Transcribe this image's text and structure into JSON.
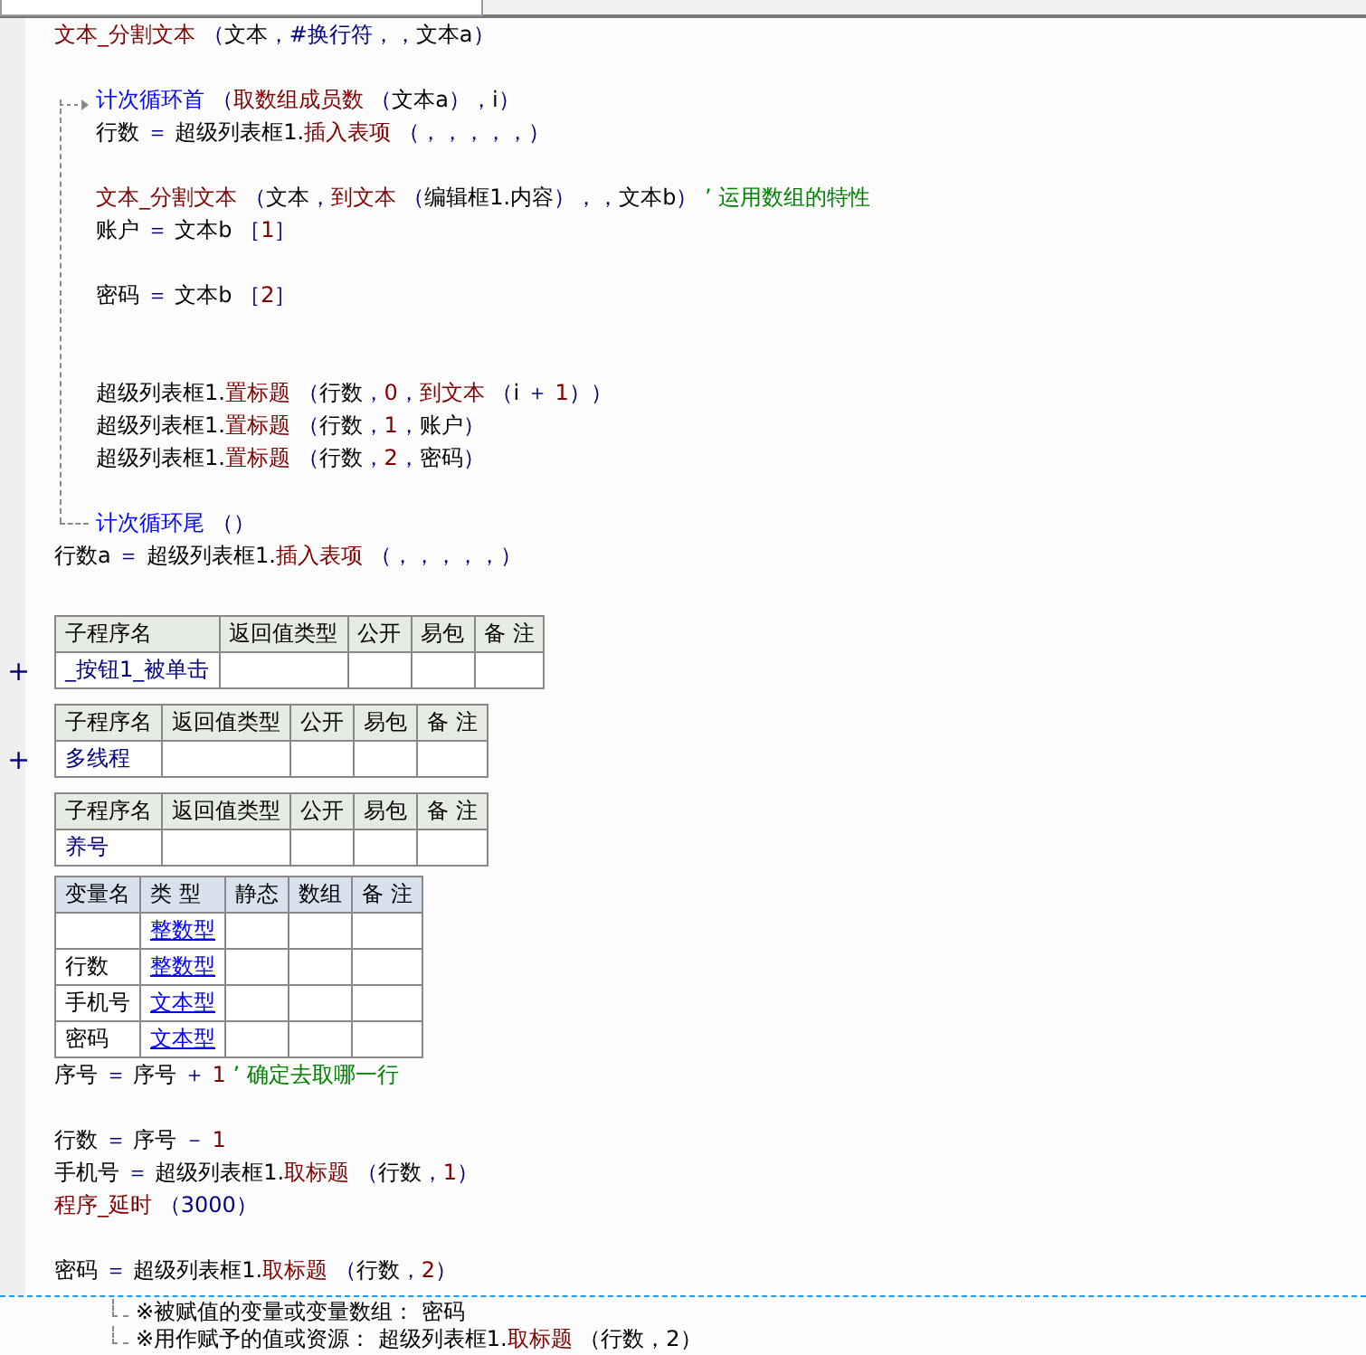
{
  "code": [
    {
      "kind": "line",
      "tokens": [
        {
          "kind": "f",
          "text": "文本_分割文本"
        },
        {
          "kind": "o",
          "text": " （"
        },
        {
          "kind": "p",
          "text": "文本"
        },
        {
          "kind": "o",
          "text": "，"
        },
        {
          "kind": "o",
          "text": "#换行符"
        },
        {
          "kind": "o",
          "text": "，，"
        },
        {
          "kind": "p",
          "text": "文本a"
        },
        {
          "kind": "o",
          "text": "）"
        }
      ]
    },
    {
      "kind": "blank"
    },
    {
      "kind": "loop",
      "head": [
        {
          "kind": "k",
          "text": "计次循环首"
        },
        {
          "kind": "o",
          "text": " （"
        },
        {
          "kind": "f",
          "text": "取数组成员数"
        },
        {
          "kind": "o",
          "text": " （"
        },
        {
          "kind": "p",
          "text": "文本a"
        },
        {
          "kind": "o",
          "text": "），"
        },
        {
          "kind": "p",
          "text": "i"
        },
        {
          "kind": "o",
          "text": "）"
        }
      ],
      "children": [
        {
          "kind": "line",
          "tokens": [
            {
              "kind": "p",
              "text": "行数"
            },
            {
              "kind": "o",
              "text": " ＝ "
            },
            {
              "kind": "p",
              "text": "超级列表框1."
            },
            {
              "kind": "f",
              "text": "插入表项"
            },
            {
              "kind": "o",
              "text": " （，，，，，）"
            }
          ]
        },
        {
          "kind": "blank"
        },
        {
          "kind": "line",
          "tokens": [
            {
              "kind": "f",
              "text": "文本_分割文本"
            },
            {
              "kind": "o",
              "text": " （"
            },
            {
              "kind": "p",
              "text": "文本"
            },
            {
              "kind": "o",
              "text": "，"
            },
            {
              "kind": "f",
              "text": "到文本"
            },
            {
              "kind": "o",
              "text": " （"
            },
            {
              "kind": "p",
              "text": "编辑框1.内容"
            },
            {
              "kind": "o",
              "text": "），，"
            },
            {
              "kind": "p",
              "text": "文本b"
            },
            {
              "kind": "o",
              "text": "）"
            },
            {
              "kind": "c",
              "text": " ’ 运用数组的特性"
            }
          ]
        },
        {
          "kind": "line",
          "tokens": [
            {
              "kind": "p",
              "text": "账户"
            },
            {
              "kind": "o",
              "text": " ＝ "
            },
            {
              "kind": "p",
              "text": "文本b "
            },
            {
              "kind": "o",
              "text": "［"
            },
            {
              "kind": "n",
              "text": "1"
            },
            {
              "kind": "o",
              "text": "］"
            }
          ]
        },
        {
          "kind": "blank"
        },
        {
          "kind": "line",
          "tokens": [
            {
              "kind": "p",
              "text": "密码"
            },
            {
              "kind": "o",
              "text": " ＝ "
            },
            {
              "kind": "p",
              "text": "文本b "
            },
            {
              "kind": "o",
              "text": "［"
            },
            {
              "kind": "n",
              "text": "2"
            },
            {
              "kind": "o",
              "text": "］"
            }
          ]
        },
        {
          "kind": "blank"
        },
        {
          "kind": "blank"
        },
        {
          "kind": "line",
          "tokens": [
            {
              "kind": "p",
              "text": "超级列表框1."
            },
            {
              "kind": "f",
              "text": "置标题"
            },
            {
              "kind": "o",
              "text": " （"
            },
            {
              "kind": "p",
              "text": "行数"
            },
            {
              "kind": "o",
              "text": "，"
            },
            {
              "kind": "n",
              "text": "0"
            },
            {
              "kind": "o",
              "text": "，"
            },
            {
              "kind": "f",
              "text": "到文本"
            },
            {
              "kind": "o",
              "text": " （"
            },
            {
              "kind": "p",
              "text": "i"
            },
            {
              "kind": "o",
              "text": " ＋ "
            },
            {
              "kind": "n",
              "text": "1"
            },
            {
              "kind": "o",
              "text": "））"
            }
          ]
        },
        {
          "kind": "line",
          "tokens": [
            {
              "kind": "p",
              "text": "超级列表框1."
            },
            {
              "kind": "f",
              "text": "置标题"
            },
            {
              "kind": "o",
              "text": " （"
            },
            {
              "kind": "p",
              "text": "行数"
            },
            {
              "kind": "o",
              "text": "，"
            },
            {
              "kind": "n",
              "text": "1"
            },
            {
              "kind": "o",
              "text": "，"
            },
            {
              "kind": "p",
              "text": "账户"
            },
            {
              "kind": "o",
              "text": "）"
            }
          ]
        },
        {
          "kind": "line",
          "tokens": [
            {
              "kind": "p",
              "text": "超级列表框1."
            },
            {
              "kind": "f",
              "text": "置标题"
            },
            {
              "kind": "o",
              "text": " （"
            },
            {
              "kind": "p",
              "text": "行数"
            },
            {
              "kind": "o",
              "text": "，"
            },
            {
              "kind": "n",
              "text": "2"
            },
            {
              "kind": "o",
              "text": "，"
            },
            {
              "kind": "p",
              "text": "密码"
            },
            {
              "kind": "o",
              "text": "）"
            }
          ]
        },
        {
          "kind": "blank"
        }
      ],
      "tail": [
        {
          "kind": "k",
          "text": "计次循环尾"
        },
        {
          "kind": "o",
          "text": " （）"
        }
      ]
    },
    {
      "kind": "line",
      "tokens": [
        {
          "kind": "p",
          "text": "行数a"
        },
        {
          "kind": "o",
          "text": " ＝ "
        },
        {
          "kind": "p",
          "text": "超级列表框1."
        },
        {
          "kind": "f",
          "text": "插入表项"
        },
        {
          "kind": "o",
          "text": " （，，，，，）"
        }
      ]
    }
  ],
  "subroutines": [
    {
      "toggle": "+",
      "columns": [
        "子程序名",
        "返回值类型",
        "公开",
        "易包",
        "备 注"
      ],
      "name": "_按钮1_被单击"
    },
    {
      "toggle": "+",
      "columns": [
        "子程序名",
        "返回值类型",
        "公开",
        "易包",
        "备 注"
      ],
      "name": "多线程"
    },
    {
      "columns": [
        "子程序名",
        "返回值类型",
        "公开",
        "易包",
        "备 注"
      ],
      "name": "养号"
    }
  ],
  "variables": {
    "columns": [
      "变量名",
      "类 型",
      "静态",
      "数组",
      "备 注"
    ],
    "rows": [
      {
        "type": "整数型"
      },
      {
        "name": "行数",
        "type": "整数型"
      },
      {
        "name": "手机号",
        "type": "文本型"
      },
      {
        "name": "密码",
        "type": "文本型"
      }
    ]
  },
  "code_after": [
    {
      "kind": "line",
      "tokens": [
        {
          "kind": "p",
          "text": "序号"
        },
        {
          "kind": "o",
          "text": " ＝ "
        },
        {
          "kind": "p",
          "text": "序号"
        },
        {
          "kind": "o",
          "text": " ＋ "
        },
        {
          "kind": "n",
          "text": "1"
        },
        {
          "kind": "c",
          "text": " ’ 确定去取哪一行"
        }
      ]
    },
    {
      "kind": "blank"
    },
    {
      "kind": "line",
      "tokens": [
        {
          "kind": "p",
          "text": "行数"
        },
        {
          "kind": "o",
          "text": " ＝ "
        },
        {
          "kind": "p",
          "text": "序号"
        },
        {
          "kind": "o",
          "text": " － "
        },
        {
          "kind": "n",
          "text": "1"
        }
      ]
    },
    {
      "kind": "line",
      "tokens": [
        {
          "kind": "p",
          "text": "手机号"
        },
        {
          "kind": "o",
          "text": " ＝ "
        },
        {
          "kind": "p",
          "text": "超级列表框1."
        },
        {
          "kind": "f",
          "text": "取标题"
        },
        {
          "kind": "o",
          "text": " （"
        },
        {
          "kind": "p",
          "text": "行数"
        },
        {
          "kind": "o",
          "text": "，"
        },
        {
          "kind": "n",
          "text": "1"
        },
        {
          "kind": "o",
          "text": "）"
        }
      ]
    },
    {
      "kind": "line",
      "tokens": [
        {
          "kind": "f",
          "text": "程序_延时"
        },
        {
          "kind": "o",
          "text": " （3000）"
        }
      ]
    },
    {
      "kind": "blank"
    },
    {
      "kind": "line",
      "tokens": [
        {
          "kind": "p",
          "text": "密码"
        },
        {
          "kind": "o",
          "text": " ＝ "
        },
        {
          "kind": "p",
          "text": "超级列表框1."
        },
        {
          "kind": "f",
          "text": "取标题"
        },
        {
          "kind": "o",
          "text": " （"
        },
        {
          "kind": "p",
          "text": "行数"
        },
        {
          "kind": "o",
          "text": "，"
        },
        {
          "kind": "n",
          "text": "2"
        },
        {
          "kind": "o",
          "text": "）"
        }
      ]
    }
  ],
  "hints": [
    [
      {
        "kind": "p",
        "text": "※被赋值的变量或变量数组： 密码"
      }
    ],
    [
      {
        "kind": "p",
        "text": "※用作赋予的值或资源： 超级列表框1."
      },
      {
        "kind": "f",
        "text": "取标题"
      },
      {
        "kind": "p",
        "text": " （行数，2）"
      }
    ]
  ]
}
